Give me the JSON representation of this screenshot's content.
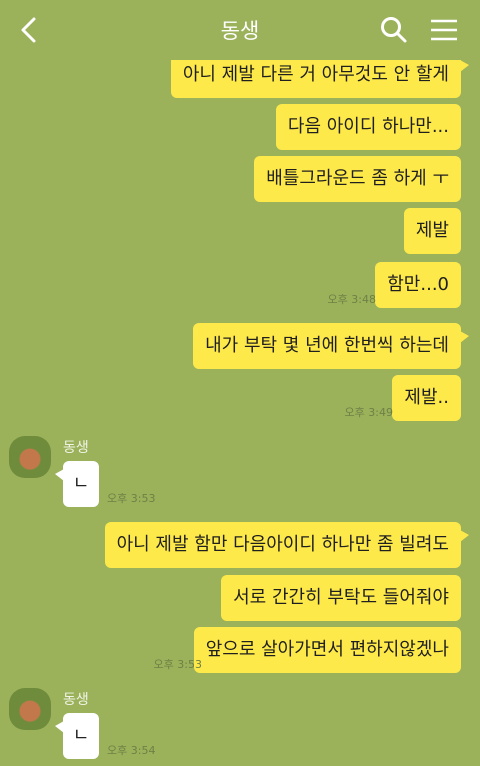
{
  "header": {
    "title": "동생",
    "back_icon": "chevron-left-icon",
    "search_icon": "search-icon",
    "menu_icon": "hamburger-menu-icon"
  },
  "sent": [
    {
      "text": "아니 제발 다른 거 아무것도 안 할게"
    },
    {
      "text": "다음 아이디 하나만..."
    },
    {
      "text": "배틀그라운드 좀 하게 ㅜ"
    },
    {
      "text": "제발"
    },
    {
      "text": "함만...0",
      "time": "오후 3:48"
    },
    {
      "text": "내가 부탁 몇 년에 한번씩 하는데"
    },
    {
      "text": "제발..",
      "time": "오후 3:49"
    },
    {
      "text": "아니 제발 함만 다음아이디 하나만 좀 빌려도"
    },
    {
      "text": "서로 간간히 부탁도 들어줘야"
    },
    {
      "text": "앞으로 살아가면서 편하지않겠나",
      "time": "오후 3:53"
    }
  ],
  "received": [
    {
      "sender": "동생",
      "text": "ㄴ",
      "time": "오후 3:53"
    },
    {
      "sender": "동생",
      "text": "ㄴ",
      "time": "오후 3:54"
    }
  ],
  "peek_text": "ㄴ",
  "colors": {
    "background": "#9bb25b",
    "sent_bubble": "#fee94a",
    "received_bubble": "#ffffff"
  }
}
